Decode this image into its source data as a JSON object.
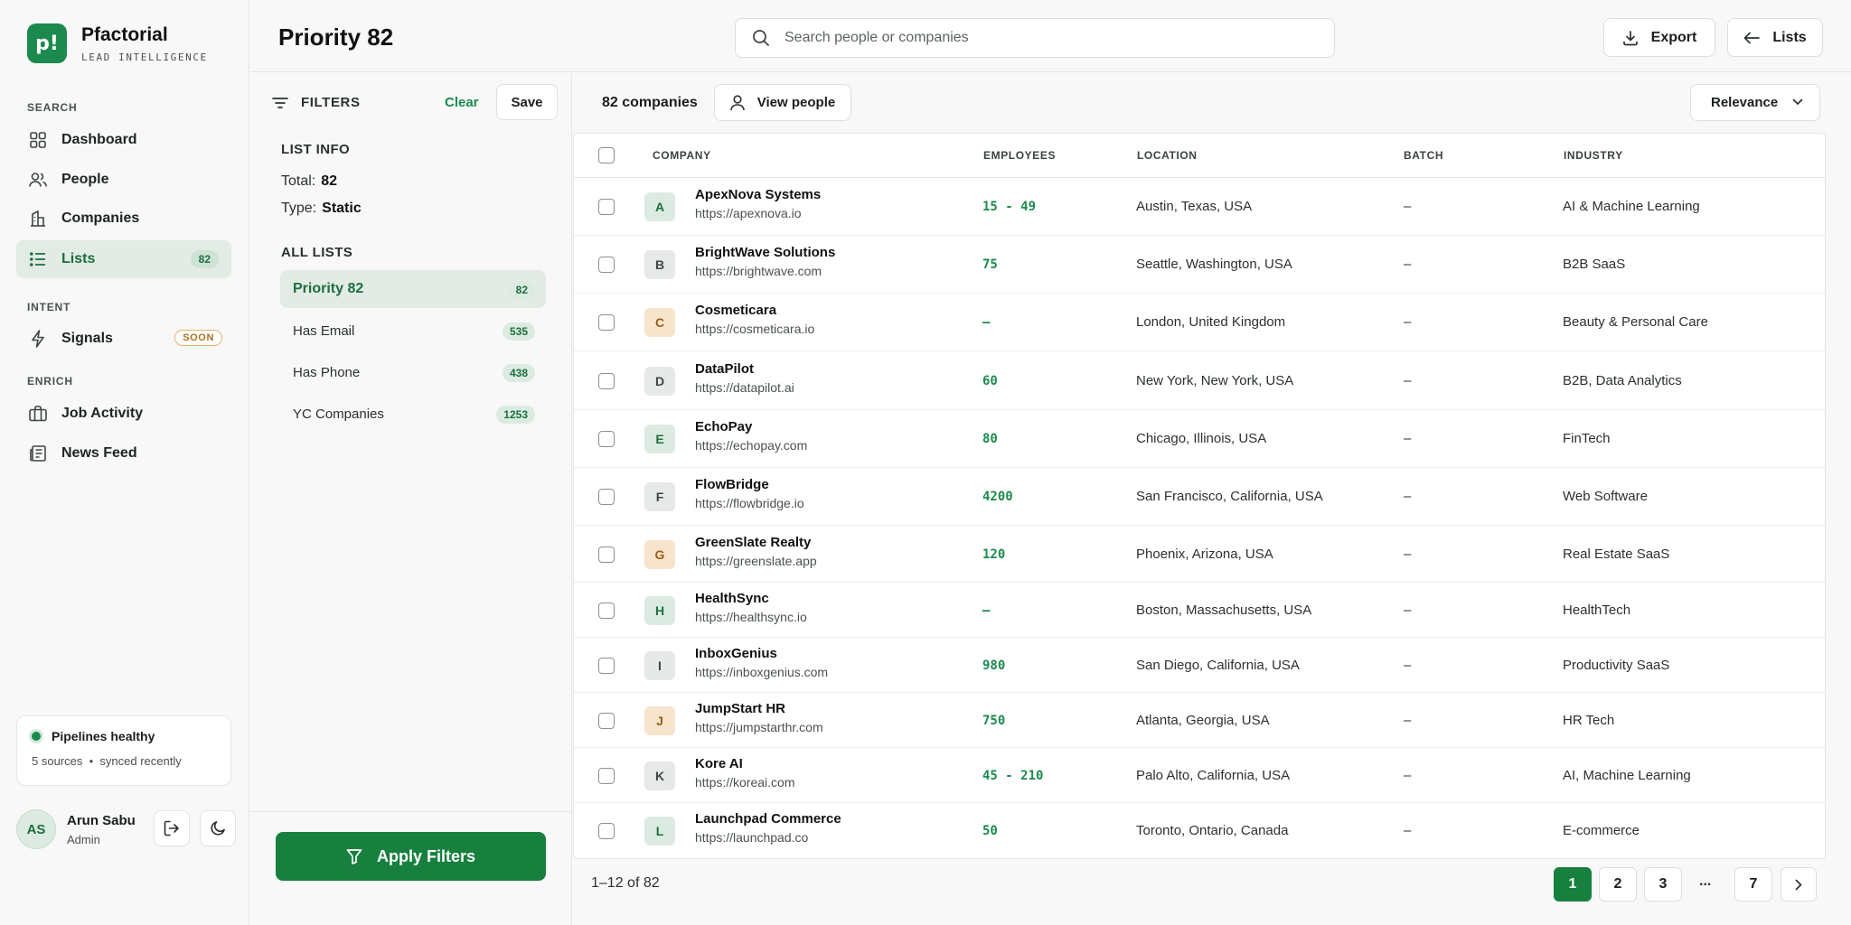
{
  "brand": {
    "logo": "p!",
    "name": "Pfactorial",
    "tagline": "LEAD INTELLIGENCE"
  },
  "sidebar": {
    "sections": {
      "search": "SEARCH",
      "intent": "INTENT",
      "enrich": "ENRICH"
    },
    "items": [
      {
        "label": "Dashboard",
        "icon": "dashboard-grid-icon"
      },
      {
        "label": "People",
        "icon": "people-icon"
      },
      {
        "label": "Companies",
        "icon": "companies-icon"
      },
      {
        "label": "Lists",
        "icon": "list-icon",
        "count": "82"
      },
      {
        "label": "Signals",
        "icon": "lightning-icon",
        "badge": "SOON"
      },
      {
        "label": "Job Activity",
        "icon": "briefcase-icon"
      },
      {
        "label": "News Feed",
        "icon": "newspaper-icon"
      }
    ],
    "pipeline": {
      "title": "Pipelines healthy",
      "sources": "5 sources",
      "separator": "•",
      "synced": "synced recently"
    },
    "user": {
      "initials": "AS",
      "name": "Arun Sabu",
      "role": "Admin"
    }
  },
  "header": {
    "title": "Priority 82",
    "search_placeholder": "Search people or companies",
    "export_label": "Export",
    "lists_label": "Lists"
  },
  "filters": {
    "heading": "FILTERS",
    "clear": "Clear",
    "save": "Save",
    "list_info_label": "LIST INFO",
    "total_label": "Total:",
    "total_value": "82",
    "type_label": "Type:",
    "type_value": "Static",
    "all_lists_label": "ALL LISTS",
    "lists": [
      {
        "name": "Priority 82",
        "count": "82"
      },
      {
        "name": "Has Email",
        "count": "535"
      },
      {
        "name": "Has Phone",
        "count": "438"
      },
      {
        "name": "YC Companies",
        "count": "1253"
      }
    ],
    "apply": "Apply Filters"
  },
  "main": {
    "count_label": "82 companies",
    "view_people": "View people",
    "sort": "Relevance",
    "columns": {
      "company": "COMPANY",
      "employees": "EMPLOYEES",
      "location": "LOCATION",
      "batch": "BATCH",
      "industry": "INDUSTRY"
    },
    "rows": [
      {
        "letter": "A",
        "name": "ApexNova Systems",
        "url": "https://apexnova.io",
        "employees": "15 - 49",
        "location": "Austin, Texas, USA",
        "batch": "–",
        "industry": "AI & Machine Learning"
      },
      {
        "letter": "B",
        "name": "BrightWave Solutions",
        "url": "https://brightwave.com",
        "employees": "75",
        "location": "Seattle, Washington, USA",
        "batch": "–",
        "industry": "B2B SaaS"
      },
      {
        "letter": "C",
        "name": "Cosmeticara",
        "url": "https://cosmeticara.io",
        "employees": "–",
        "location": "London, United Kingdom",
        "batch": "–",
        "industry": "Beauty & Personal Care"
      },
      {
        "letter": "D",
        "name": "DataPilot",
        "url": "https://datapilot.ai",
        "employees": "60",
        "location": "New York, New York, USA",
        "batch": "–",
        "industry": "B2B, Data Analytics"
      },
      {
        "letter": "E",
        "name": "EchoPay",
        "url": "https://echopay.com",
        "employees": "80",
        "location": "Chicago, Illinois, USA",
        "batch": "–",
        "industry": "FinTech"
      },
      {
        "letter": "F",
        "name": "FlowBridge",
        "url": "https://flowbridge.io",
        "employees": "4200",
        "location": "San Francisco, California, USA",
        "batch": "–",
        "industry": "Web Software"
      },
      {
        "letter": "G",
        "name": "GreenSlate Realty",
        "url": "https://greenslate.app",
        "employees": "120",
        "location": "Phoenix, Arizona, USA",
        "batch": "–",
        "industry": "Real Estate SaaS"
      },
      {
        "letter": "H",
        "name": "HealthSync",
        "url": "https://healthsync.io",
        "employees": "–",
        "location": "Boston, Massachusetts, USA",
        "batch": "–",
        "industry": "HealthTech"
      },
      {
        "letter": "I",
        "name": "InboxGenius",
        "url": "https://inboxgenius.com",
        "employees": "980",
        "location": "San Diego, California, USA",
        "batch": "–",
        "industry": "Productivity SaaS"
      },
      {
        "letter": "J",
        "name": "JumpStart HR",
        "url": "https://jumpstarthr.com",
        "employees": "750",
        "location": "Atlanta, Georgia, USA",
        "batch": "–",
        "industry": "HR Tech"
      },
      {
        "letter": "K",
        "name": "Kore AI",
        "url": "https://koreai.com",
        "employees": "45 - 210",
        "location": "Palo Alto, California, USA",
        "batch": "–",
        "industry": "AI, Machine Learning"
      },
      {
        "letter": "L",
        "name": "Launchpad Commerce",
        "url": "https://launchpad.co",
        "employees": "50",
        "location": "Toronto, Ontario, Canada",
        "batch": "–",
        "industry": "E-commerce"
      }
    ],
    "pagination": {
      "range": "1–12 of  82",
      "pages": [
        "1",
        "2",
        "3",
        "7"
      ],
      "ellipsis": "...",
      "current": "1"
    }
  },
  "colors": {
    "brand": "#1c8a4e",
    "accent_dark": "#17803f",
    "active_bg": "#e3ebe5",
    "badge_orange": "#e8b16b"
  }
}
